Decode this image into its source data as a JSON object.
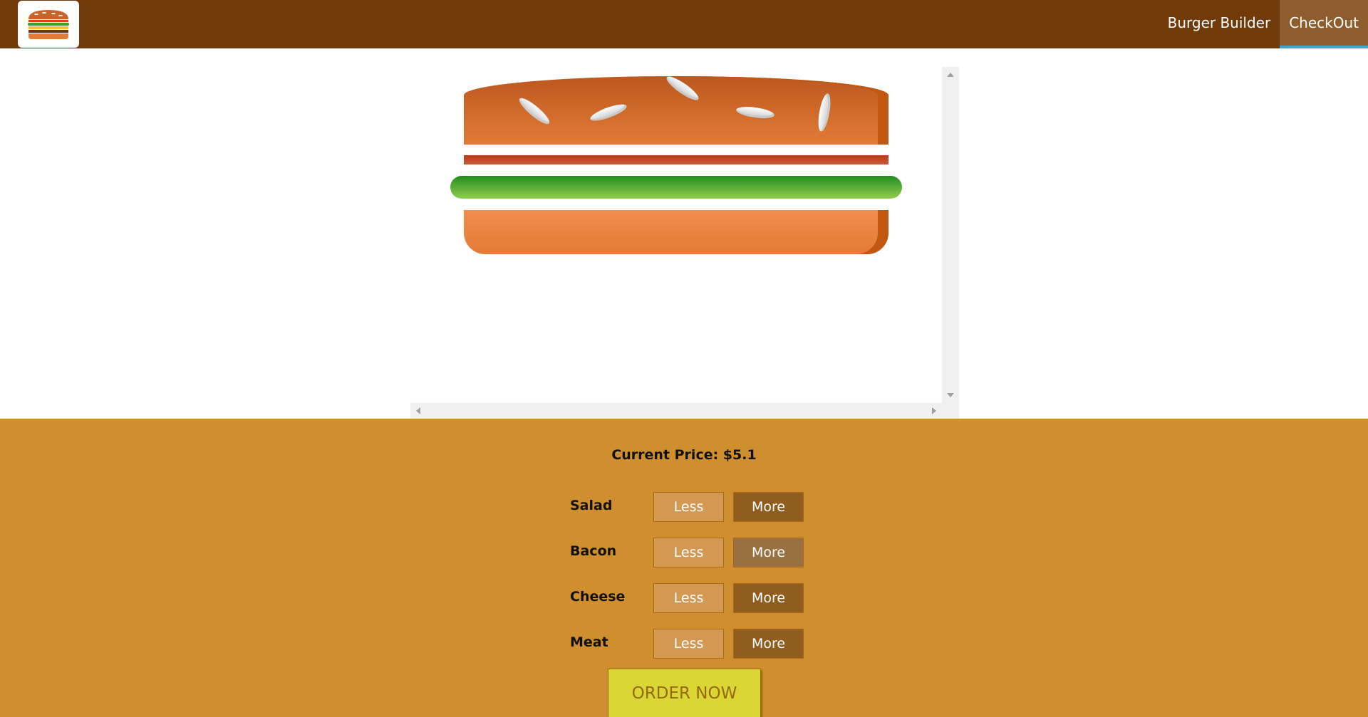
{
  "nav": {
    "items": [
      {
        "label": "Burger Builder"
      },
      {
        "label": "CheckOut"
      }
    ]
  },
  "controls": {
    "price_label": "Current Price: $5.1",
    "less_label": "Less",
    "more_label": "More",
    "ingredients": [
      {
        "label": "Salad"
      },
      {
        "label": "Bacon"
      },
      {
        "label": "Cheese"
      },
      {
        "label": "Meat"
      }
    ],
    "order_label": "ORDER NOW"
  },
  "colors": {
    "toolbar": "#703b09",
    "controls_bg": "#cf8f2e",
    "less_button": "#d39952",
    "more_button": "#8f5e1e",
    "order_button": "#dad735"
  }
}
